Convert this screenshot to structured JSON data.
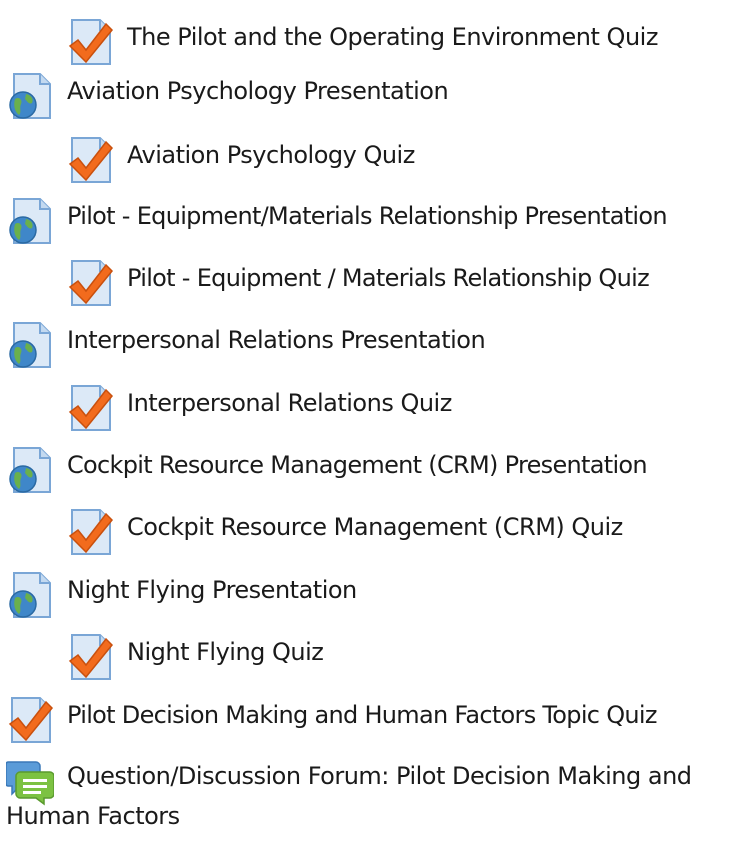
{
  "activities": [
    {
      "label": "The Pilot and the Operating Environment Quiz",
      "icon": "quiz-icon"
    },
    {
      "label": "Aviation Psychology Presentation",
      "icon": "url-resource-icon"
    },
    {
      "label": "Aviation Psychology Quiz",
      "icon": "quiz-icon"
    },
    {
      "label": "Pilot - Equipment/Materials Relationship Presentation",
      "icon": "url-resource-icon"
    },
    {
      "label": "Pilot - Equipment / Materials Relationship Quiz",
      "icon": "quiz-icon"
    },
    {
      "label": "Interpersonal Relations Presentation",
      "icon": "url-resource-icon"
    },
    {
      "label": "Interpersonal Relations Quiz",
      "icon": "quiz-icon"
    },
    {
      "label": "Cockpit Resource Management (CRM) Presentation",
      "icon": "url-resource-icon"
    },
    {
      "label": "Cockpit Resource Management (CRM) Quiz",
      "icon": "quiz-icon"
    },
    {
      "label": "Night Flying Presentation",
      "icon": "url-resource-icon"
    },
    {
      "label": "Night Flying Quiz",
      "icon": "quiz-icon"
    },
    {
      "label": "Pilot Decision Making and Human Factors Topic Quiz",
      "icon": "quiz-icon"
    },
    {
      "label": "Question/Discussion Forum: Pilot Decision Making and Human Factors",
      "icon": "forum-icon"
    }
  ],
  "colors": {
    "text": "#1a1a1a",
    "page_fill": "#dce9f7",
    "page_stroke": "#7aa6d6",
    "check": "#f26b1d",
    "check_dark": "#c9500e",
    "globe_blue": "#3f87c9",
    "globe_green": "#6ab04c",
    "forum_blue": "#5a9bd8",
    "forum_green": "#7cc242"
  }
}
